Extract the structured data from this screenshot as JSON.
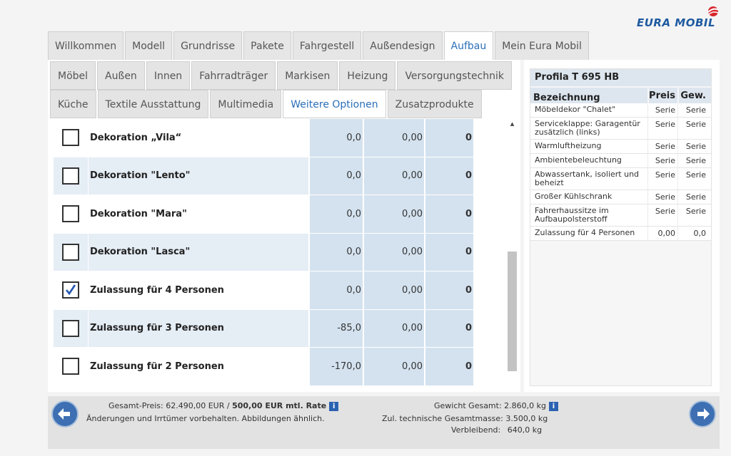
{
  "brand": {
    "logo_text": "EURA MOBIL",
    "accent": "#1e5aa0",
    "logo_red": "#d7262d"
  },
  "main_tabs": [
    {
      "label": "Willkommen"
    },
    {
      "label": "Modell"
    },
    {
      "label": "Grundrisse"
    },
    {
      "label": "Pakete"
    },
    {
      "label": "Fahrgestell"
    },
    {
      "label": "Außendesign"
    },
    {
      "label": "Aufbau",
      "active": true
    },
    {
      "label": "Mein Eura Mobil"
    }
  ],
  "sub_tabs_row1": [
    {
      "label": "Möbel"
    },
    {
      "label": "Außen"
    },
    {
      "label": "Innen"
    },
    {
      "label": "Fahrradträger"
    },
    {
      "label": "Markisen"
    },
    {
      "label": "Heizung"
    },
    {
      "label": "Versorgungstechnik"
    }
  ],
  "sub_tabs_row2": [
    {
      "label": "Küche"
    },
    {
      "label": "Textile Ausstattung"
    },
    {
      "label": "Multimedia"
    },
    {
      "label": "Weitere Optionen",
      "active": true
    },
    {
      "label": "Zusatzprodukte"
    }
  ],
  "options": [
    {
      "name": "Dekoration „Vila“",
      "price": "0,0",
      "weight": "0,00",
      "weight2": "0",
      "checked": false
    },
    {
      "name": "Dekoration \"Lento\"",
      "price": "0,0",
      "weight": "0,00",
      "weight2": "0",
      "checked": false
    },
    {
      "name": "Dekoration \"Mara\"",
      "price": "0,0",
      "weight": "0,00",
      "weight2": "0",
      "checked": false
    },
    {
      "name": "Dekoration \"Lasca\"",
      "price": "0,0",
      "weight": "0,00",
      "weight2": "0",
      "checked": false
    },
    {
      "name": "Zulassung für 4 Personen",
      "price": "0,0",
      "weight": "0,00",
      "weight2": "0",
      "checked": true
    },
    {
      "name": "Zulassung für 3 Personen",
      "price": "-85,0",
      "weight": "0,00",
      "weight2": "0",
      "checked": false
    },
    {
      "name": "Zulassung für 2 Personen",
      "price": "-170,0",
      "weight": "0,00",
      "weight2": "0",
      "checked": false
    }
  ],
  "summary": {
    "title": "Profila T 695 HB",
    "col_name": "Bezeichnung",
    "col_preis": "Preis",
    "col_gew": "Gew.",
    "rows": [
      {
        "name": "Möbeldekor \"Chalet\"",
        "preis": "Serie",
        "gew": "Serie"
      },
      {
        "name": "Serviceklappe: Garagentür zusätzlich (links)",
        "preis": "Serie",
        "gew": "Serie"
      },
      {
        "name": "Warmluftheizung",
        "preis": "Serie",
        "gew": "Serie"
      },
      {
        "name": "Ambientebeleuchtung",
        "preis": "Serie",
        "gew": "Serie"
      },
      {
        "name": "Abwassertank, isoliert und beheizt",
        "preis": "Serie",
        "gew": "Serie"
      },
      {
        "name": "Großer Kühlschrank",
        "preis": "Serie",
        "gew": "Serie"
      },
      {
        "name": "Fahrerhaussitze im Aufbaupolsterstoff",
        "preis": "Serie",
        "gew": "Serie"
      },
      {
        "name": "Zulassung für 4 Personen",
        "preis": "0,00",
        "gew": "0,0"
      }
    ]
  },
  "footer": {
    "price_label": "Gesamt-Preis: 62.490,00 EUR / ",
    "rate": "500,00 EUR mtl. Rate",
    "disclaimer": "Änderungen und Irrtümer vorbehalten. Abbildungen ähnlich.",
    "weight_total": "Gewicht Gesamt: 2.860,0 kg",
    "tech_mass": "Zul. technische Gesamtmasse: 3.500,0 kg",
    "remaining_label": "Verbleibend:",
    "remaining_value": "640,0 kg",
    "info_glyph": "i"
  },
  "icons": {
    "back": "arrow-left-icon",
    "forward": "arrow-right-icon",
    "info": "info-icon",
    "check": "checkmark-icon",
    "scroll_up": "▴"
  }
}
